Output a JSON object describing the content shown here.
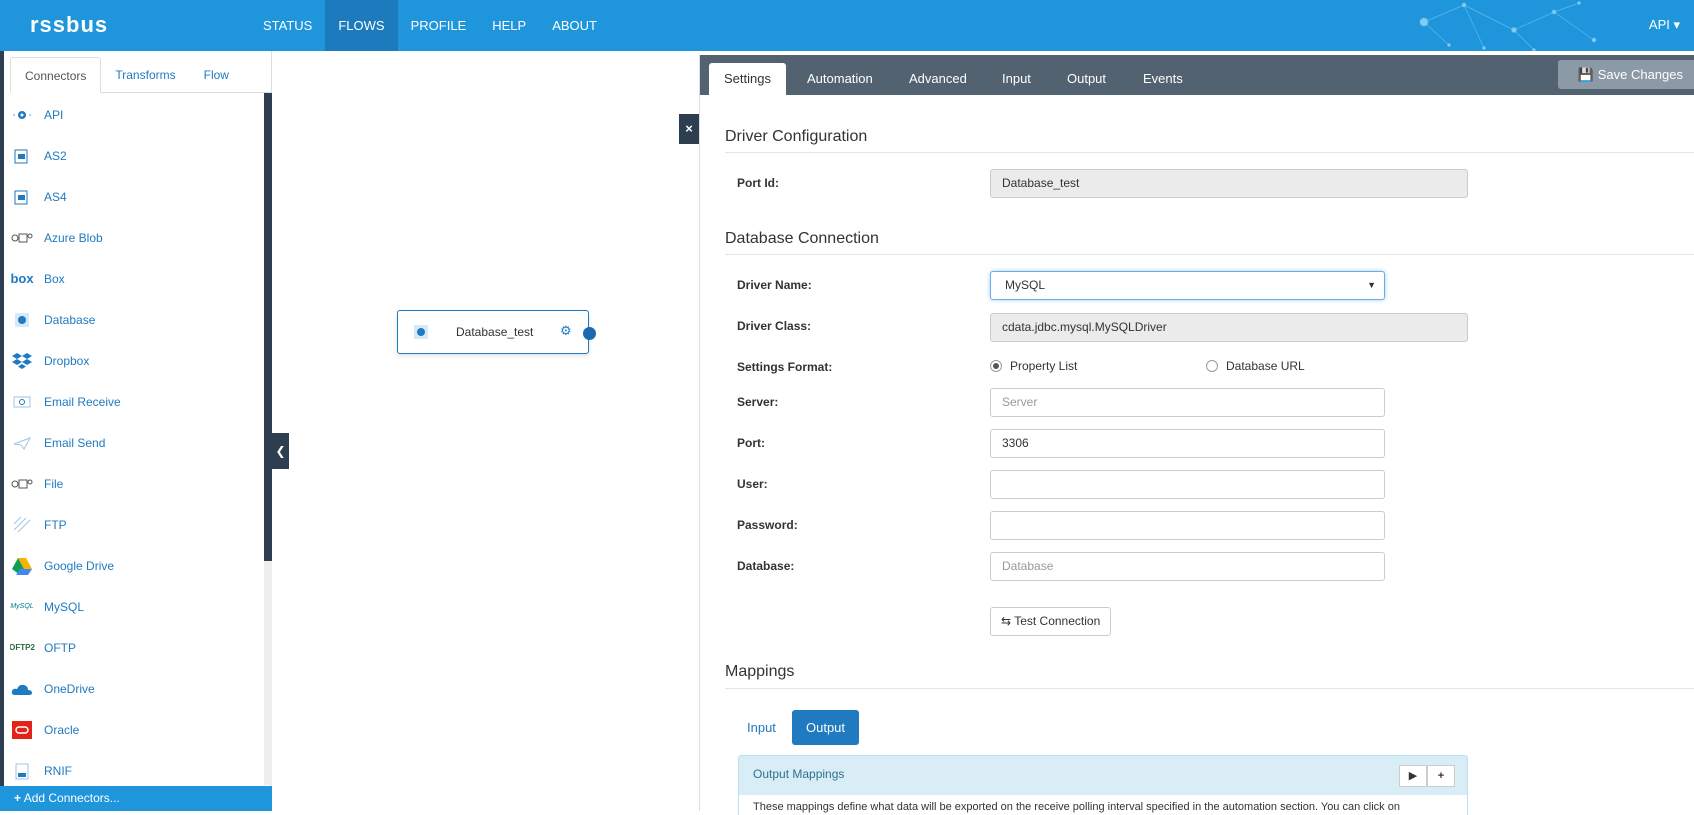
{
  "header": {
    "logo": "rssbus",
    "nav": [
      "STATUS",
      "FLOWS",
      "PROFILE",
      "HELP",
      "ABOUT"
    ],
    "active_nav": "FLOWS",
    "user_menu": "API ▾"
  },
  "sidebar": {
    "tabs": [
      "Connectors",
      "Transforms",
      "Flow"
    ],
    "active_tab": "Connectors",
    "connectors": [
      {
        "label": "API",
        "icon": "api-icon"
      },
      {
        "label": "AS2",
        "icon": "as2-icon"
      },
      {
        "label": "AS4",
        "icon": "as4-icon"
      },
      {
        "label": "Azure Blob",
        "icon": "azure-blob-icon"
      },
      {
        "label": "Box",
        "icon": "box-icon"
      },
      {
        "label": "Database",
        "icon": "database-icon"
      },
      {
        "label": "Dropbox",
        "icon": "dropbox-icon"
      },
      {
        "label": "Email Receive",
        "icon": "email-receive-icon"
      },
      {
        "label": "Email Send",
        "icon": "email-send-icon"
      },
      {
        "label": "File",
        "icon": "file-icon"
      },
      {
        "label": "FTP",
        "icon": "ftp-icon"
      },
      {
        "label": "Google Drive",
        "icon": "google-drive-icon"
      },
      {
        "label": "MySQL",
        "icon": "mysql-icon"
      },
      {
        "label": "OFTP",
        "icon": "oftp-icon"
      },
      {
        "label": "OneDrive",
        "icon": "onedrive-icon"
      },
      {
        "label": "Oracle",
        "icon": "oracle-icon"
      },
      {
        "label": "RNIF",
        "icon": "rnif-icon"
      }
    ],
    "add_connectors": "Add Connectors..."
  },
  "canvas": {
    "node_label": "Database_test"
  },
  "settings": {
    "tabs": [
      "Settings",
      "Automation",
      "Advanced",
      "Input",
      "Output",
      "Events"
    ],
    "active_tab": "Settings",
    "save_label": "Save Changes",
    "driver_config_title": "Driver Configuration",
    "port_id_label": "Port Id:",
    "port_id_value": "Database_test",
    "db_conn_title": "Database Connection",
    "driver_name_label": "Driver Name:",
    "driver_name_value": "MySQL",
    "driver_class_label": "Driver Class:",
    "driver_class_value": "cdata.jdbc.mysql.MySQLDriver",
    "settings_format_label": "Settings Format:",
    "format_option_1": "Property List",
    "format_option_2": "Database URL",
    "server_label": "Server:",
    "server_placeholder": "Server",
    "port_label": "Port:",
    "port_value": "3306",
    "user_label": "User:",
    "user_value": "",
    "password_label": "Password:",
    "password_value": "",
    "database_label": "Database:",
    "database_placeholder": "Database",
    "test_connection": "Test Connection",
    "mappings_title": "Mappings",
    "mapping_tabs": [
      "Input",
      "Output"
    ],
    "mapping_active": "Output",
    "output_mappings_title": "Output Mappings",
    "output_mappings_text": "These mappings define what data will be exported on the receive polling interval specified in the automation section. You can click on"
  },
  "colors": {
    "brand": "#1f95db",
    "dark": "#2d3e50",
    "link": "#1f7ac0"
  }
}
